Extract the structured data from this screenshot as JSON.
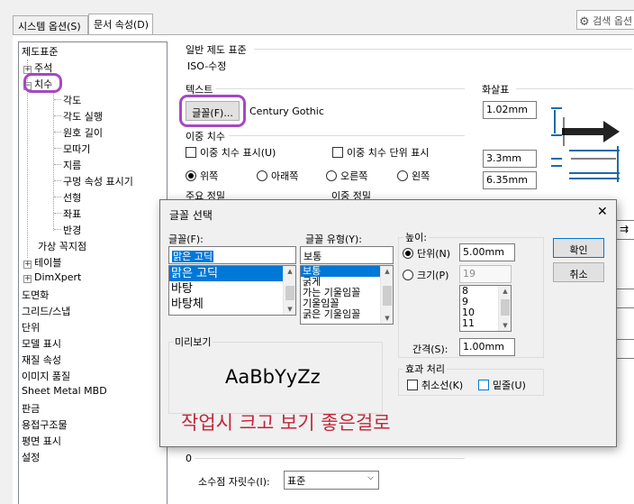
{
  "tabs": [
    {
      "label": "시스템 옵션(S)"
    },
    {
      "label": "문서 속성(D)"
    }
  ],
  "search": {
    "label": "검색 옵션"
  },
  "tree": {
    "items": [
      {
        "label": "제도표준"
      },
      {
        "label": "주석"
      },
      {
        "label": "치수"
      },
      {
        "label": "각도"
      },
      {
        "label": "각도 실행"
      },
      {
        "label": "원호 길이"
      },
      {
        "label": "모따기"
      },
      {
        "label": "지름"
      },
      {
        "label": "구멍 속성 표시기"
      },
      {
        "label": "선형"
      },
      {
        "label": "좌표"
      },
      {
        "label": "반경"
      },
      {
        "label": "가상 꼭지점"
      },
      {
        "label": "테이블"
      },
      {
        "label": "DimXpert"
      },
      {
        "label": "도면화"
      },
      {
        "label": "그리드/스냅"
      },
      {
        "label": "단위"
      },
      {
        "label": "모델 표시"
      },
      {
        "label": "재질 속성"
      },
      {
        "label": "이미지 품질"
      },
      {
        "label": "Sheet Metal MBD"
      },
      {
        "label": "판금"
      },
      {
        "label": "용접구조물"
      },
      {
        "label": "평면 표시"
      },
      {
        "label": "설정"
      }
    ]
  },
  "main": {
    "standard_group": "일반 제도 표준",
    "standard_value": "ISO-수정",
    "text_group": "텍스트",
    "font_button": "글꼴(F)...",
    "font_name": "Century Gothic",
    "dual_group": "이중 치수",
    "dual_show": "이중 치수 표시(U)",
    "dual_units": "이중 치수 단위 표시",
    "pos_top": "위쪽",
    "pos_bottom": "아래쪽",
    "pos_right": "오른쪽",
    "pos_left": "왼쪽",
    "primary_precision": "주요 정밀",
    "dual_precision": "이중 정밀",
    "arrow_group": "화살표",
    "arrow_1": "1.02mm",
    "arrow_2": "3.3mm",
    "arrow_3": "6.35mm",
    "zero_label": "0",
    "decimal_label": "소수점 자릿수(I):",
    "decimal_value": "표준"
  },
  "dialog": {
    "title": "글꼴 선택",
    "close": "✕",
    "font_label": "글꼴(F):",
    "font_value": "맑은 고딕",
    "fonts": [
      "맑은 고딕",
      "바탕",
      "바탕체"
    ],
    "style_label": "글꼴 유형(Y):",
    "style_value": "보통",
    "styles": [
      "보통",
      "굵게",
      "가는 기울임꼴",
      "기울임꼴",
      "굵은 기울임꼴"
    ],
    "height_label": "높이:",
    "units_label": "단위(N)",
    "units_value": "5.00mm",
    "points_label": "크기(P)",
    "points_value": "19",
    "sizes": [
      "8",
      "9",
      "10",
      "11"
    ],
    "spacing_label": "간격(S):",
    "spacing_value": "1.00mm",
    "ok": "확인",
    "cancel": "취소",
    "preview_label": "미리보기",
    "preview_text": "AaBbYyZz",
    "effects_label": "효과 처리",
    "strikeout": "취소선(K)",
    "underline": "밑줄(U)"
  },
  "annotation": {
    "text": "작업시 크고 보기 좋은걸로",
    "color": "#c0283a"
  },
  "colors": {
    "highlight": "#a548c4",
    "selection": "#0078d7",
    "arrow_dim": "#1e6aa8"
  }
}
